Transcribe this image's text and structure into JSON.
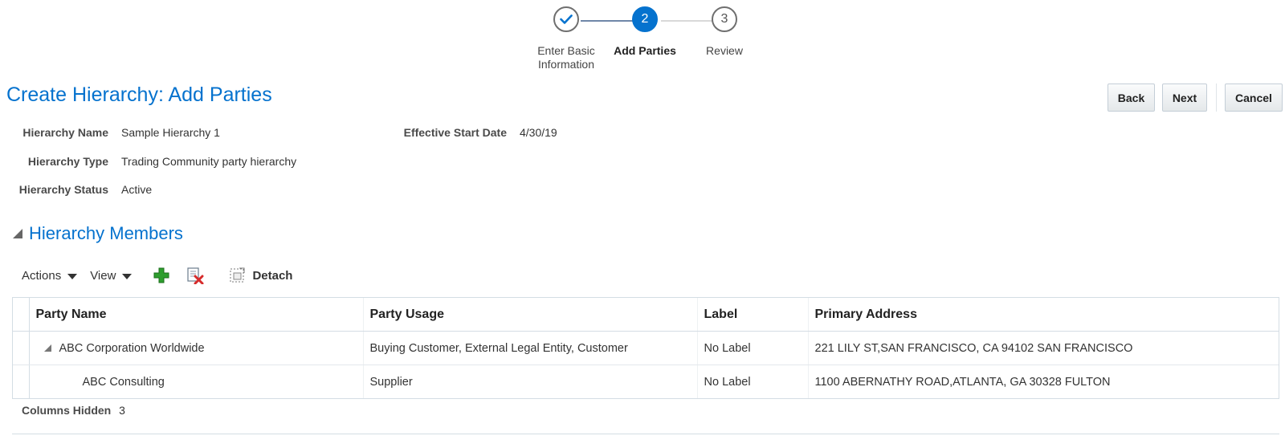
{
  "train": {
    "steps": [
      {
        "number": "",
        "label_line1": "Enter Basic",
        "label_line2": "Information",
        "state": "done"
      },
      {
        "number": "2",
        "label_line1": "Add Parties",
        "label_line2": "",
        "state": "current"
      },
      {
        "number": "3",
        "label_line1": "Review",
        "label_line2": "",
        "state": "todo"
      }
    ]
  },
  "page": {
    "title": "Create Hierarchy: Add Parties",
    "buttons": {
      "back": "Back",
      "next": "Next",
      "cancel": "Cancel"
    }
  },
  "fields": {
    "hierarchy_name": {
      "label": "Hierarchy Name",
      "value": "Sample Hierarchy 1"
    },
    "hierarchy_type": {
      "label": "Hierarchy Type",
      "value": "Trading Community party hierarchy"
    },
    "hierarchy_status": {
      "label": "Hierarchy Status",
      "value": "Active"
    },
    "effective_start_date": {
      "label": "Effective Start Date",
      "value": "4/30/19"
    }
  },
  "members": {
    "title": "Hierarchy Members",
    "toolbar": {
      "actions": "Actions",
      "view": "View",
      "detach": "Detach"
    },
    "columns": [
      "Party Name",
      "Party Usage",
      "Label",
      "Primary Address"
    ],
    "rows": [
      {
        "party_name": "ABC Corporation Worldwide",
        "party_usage": "Buying Customer, External Legal Entity, Customer",
        "label": "No Label",
        "primary_address": "221 LILY ST,SAN FRANCISCO, CA 94102 SAN FRANCISCO"
      },
      {
        "party_name": "ABC Consulting",
        "party_usage": "Supplier",
        "label": "No Label",
        "primary_address": "1100 ABERNATHY ROAD,ATLANTA, GA 30328 FULTON"
      }
    ],
    "footer": {
      "label": "Columns Hidden",
      "value": "3"
    }
  },
  "colors": {
    "accent": "#0572ce",
    "add_icon": "#2e9e2e",
    "delete_icon": "#d62b2b"
  }
}
